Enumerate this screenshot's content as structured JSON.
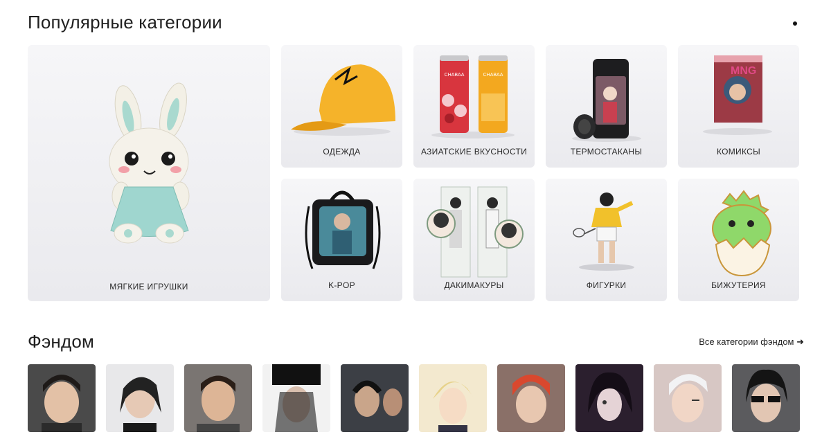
{
  "popular": {
    "title": "Популярные категории",
    "categories": [
      {
        "label": "Мягкие игрушки"
      },
      {
        "label": "Одежда"
      },
      {
        "label": "Азиатские вкусности"
      },
      {
        "label": "Термостаканы"
      },
      {
        "label": "Комиксы"
      },
      {
        "label": "K-POP"
      },
      {
        "label": "Дакимакуры"
      },
      {
        "label": "Фигурки"
      },
      {
        "label": "Бижутерия"
      }
    ]
  },
  "fandom": {
    "title": "Фэндом",
    "all_link": "Все категории фэндом ➜",
    "avatar_count": 10
  },
  "product_texts": {
    "can_brand": "CHABAA",
    "comic_title": "MNG"
  },
  "colors": {
    "card_bg": "#eeeef1",
    "cap_yellow": "#f5b32a",
    "bunny_dress": "#9fd6cf",
    "dino_green": "#8fd86a"
  }
}
